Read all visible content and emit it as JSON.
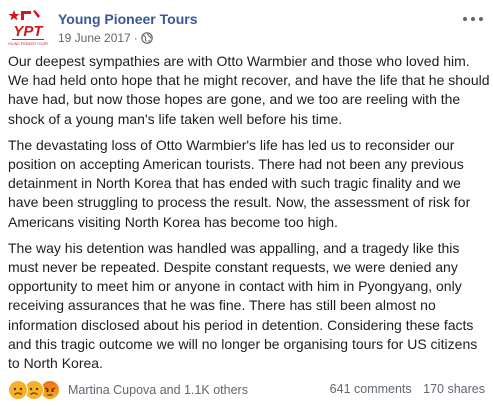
{
  "post": {
    "page_name": "Young Pioneer Tours",
    "date": "19 June 2017",
    "separator": "·",
    "paragraphs": [
      "Our deepest sympathies are with Otto Warmbier and those who loved him. We had held onto hope that he might recover, and have the life that he should have had, but now those hopes are gone, and we too are reeling with the shock of a young man's life taken well before his time.",
      "The devastating loss of Otto Warmbier's life has led us to reconsider our position on accepting American tourists. There had not been any previous detainment in North Korea that has ended with such tragic finality and we have been struggling to process the result. Now, the assessment of risk for Americans visiting North Korea has become too high.",
      "The way his detention was handled was appalling, and a tragedy like this must never be repeated. Despite constant requests, we were denied any opportunity to meet him or anyone in contact with him in Pyongyang, only receiving assurances that he was fine. There has still been almost no information disclosed about his period in detention. Considering these facts and this tragic outcome we will no longer be organising tours for US citizens to North Korea."
    ]
  },
  "logo": {
    "letters": "YPT",
    "caption": "YOUNG PIONEER TOURS",
    "color": "#d4161c"
  },
  "footer": {
    "reactors": "Martina Cupova and 1.1K others",
    "comments": "641 comments",
    "shares": "170 shares",
    "reaction_icons": [
      "sad-reaction-icon",
      "sad-reaction-icon",
      "angry-reaction-icon"
    ]
  },
  "colors": {
    "link": "#385898",
    "meta": "#606770",
    "text": "#1c1e21"
  }
}
